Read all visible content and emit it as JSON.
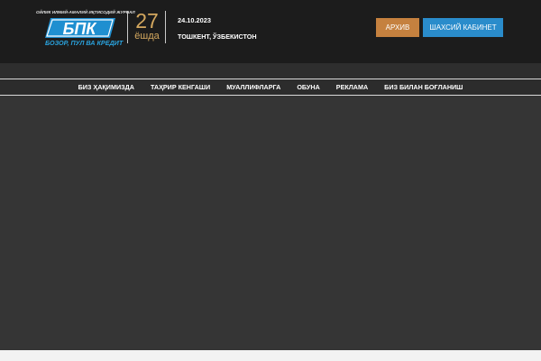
{
  "header": {
    "logo": {
      "tagline": "ОЙЛИК ИЛМИЙ-АМАЛИЙ ИҚТИСОДИЙ ЖУРНАЛ",
      "mark": "БПК",
      "subtitle": "БОЗОР, ПУЛ ВА КРЕДИТ"
    },
    "anniversary": {
      "number": "27",
      "label": "ёшда"
    },
    "date": "24.10.2023",
    "city": "ТОШКЕНТ, ЎЗБЕКИСТОН",
    "buttons": {
      "archive": "АРХИВ",
      "cabinet": "ШАХСИЙ КАБИНЕТ"
    }
  },
  "nav": {
    "items": [
      {
        "label": "БИЗ ҲАҚИМИЗДА"
      },
      {
        "label": "ТАҲРИР КЕНГАШИ"
      },
      {
        "label": "МУАЛЛИФЛАРГА"
      },
      {
        "label": "ОБУНА"
      },
      {
        "label": "РЕКЛАМА"
      },
      {
        "label": "БИЗ БИЛАН БОҒЛАНИШ"
      }
    ]
  },
  "colors": {
    "header_bg": "#1c1c1c",
    "page_bg": "#353535",
    "accent_gold": "#d4a85f",
    "archive_button": "#c5813f",
    "cabinet_button": "#2a8ccb",
    "logo_blue": "#2aa3de"
  }
}
